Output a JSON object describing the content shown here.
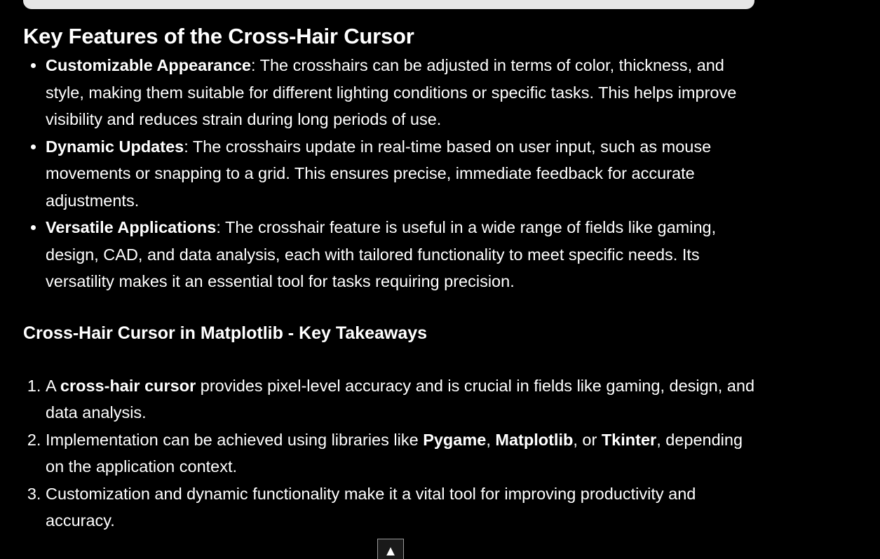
{
  "features": {
    "heading": "Key Features of the Cross-Hair Cursor",
    "items": [
      {
        "title": "Customizable Appearance",
        "text": ": The crosshairs can be adjusted in terms of color, thickness, and style, making them suitable for different lighting conditions or specific tasks. This helps improve visibility and reduces strain during long periods of use."
      },
      {
        "title": "Dynamic Updates",
        "text": ": The crosshairs update in real-time based on user input, such as mouse movements or snapping to a grid. This ensures precise, immediate feedback for accurate adjustments."
      },
      {
        "title": "Versatile Applications",
        "text": ": The crosshair feature is useful in a wide range of fields like gaming, design, CAD, and data analysis, each with tailored functionality to meet specific needs. Its versatility makes it an essential tool for tasks requiring precision."
      }
    ]
  },
  "takeaways": {
    "heading": "Cross-Hair Cursor in Matplotlib - Key Takeaways",
    "item1": {
      "prefix": "A ",
      "bold": "cross-hair cursor",
      "suffix": " provides pixel-level accuracy and is crucial in fields like gaming, design, and data analysis."
    },
    "item2": {
      "prefix": "Implementation can be achieved using libraries like ",
      "lib1": "Pygame",
      "sep1": ", ",
      "lib2": "Matplotlib",
      "sep2": ", or ",
      "lib3": "Tkinter",
      "suffix": ", depending on the application context."
    },
    "item3": {
      "text": "Customization and dynamic functionality make it a vital tool for improving productivity and accuracy."
    }
  },
  "scroll_top": {
    "icon": "up-arrow-icon",
    "glyph": "▲"
  }
}
